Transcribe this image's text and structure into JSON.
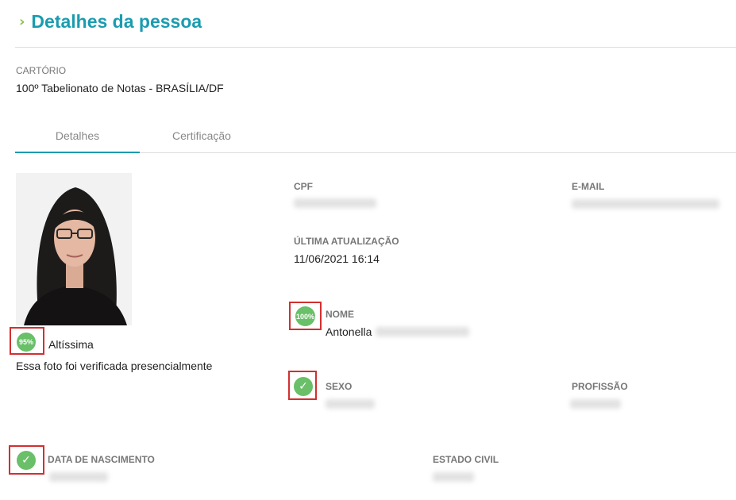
{
  "header": {
    "title": "Detalhes da pessoa"
  },
  "cartorio": {
    "label": "CARTÓRIO",
    "value": "100º Tabelionato de Notas - BRASÍLIA/DF"
  },
  "tabs": [
    {
      "label": "Detalhes",
      "active": true
    },
    {
      "label": "Certificação",
      "active": false
    }
  ],
  "photo": {
    "score_badge": "95%",
    "score_text": "Altíssima",
    "verification_note": "Essa foto foi verificada presencialmente"
  },
  "fields": {
    "cpf": {
      "label": "CPF"
    },
    "email": {
      "label": "E-MAIL"
    },
    "ultima_atualizacao": {
      "label": "ÚLTIMA ATUALIZAÇÃO",
      "value": "11/06/2021 16:14"
    },
    "nome": {
      "label": "NOME",
      "value": "Antonella",
      "badge": "100%"
    },
    "sexo": {
      "label": "SEXO"
    },
    "profissao": {
      "label": "PROFISSÃO"
    },
    "data_nascimento": {
      "label": "DATA DE NASCIMENTO"
    },
    "estado_civil": {
      "label": "ESTADO CIVIL"
    }
  },
  "colors": {
    "accent": "#1a9cb0",
    "badge_green": "#6abf69",
    "highlight_red": "#d32f2f",
    "chevron": "#8bc34a"
  },
  "icons": {
    "title": "chevron-right-icon",
    "verified": "check-circle-icon"
  }
}
